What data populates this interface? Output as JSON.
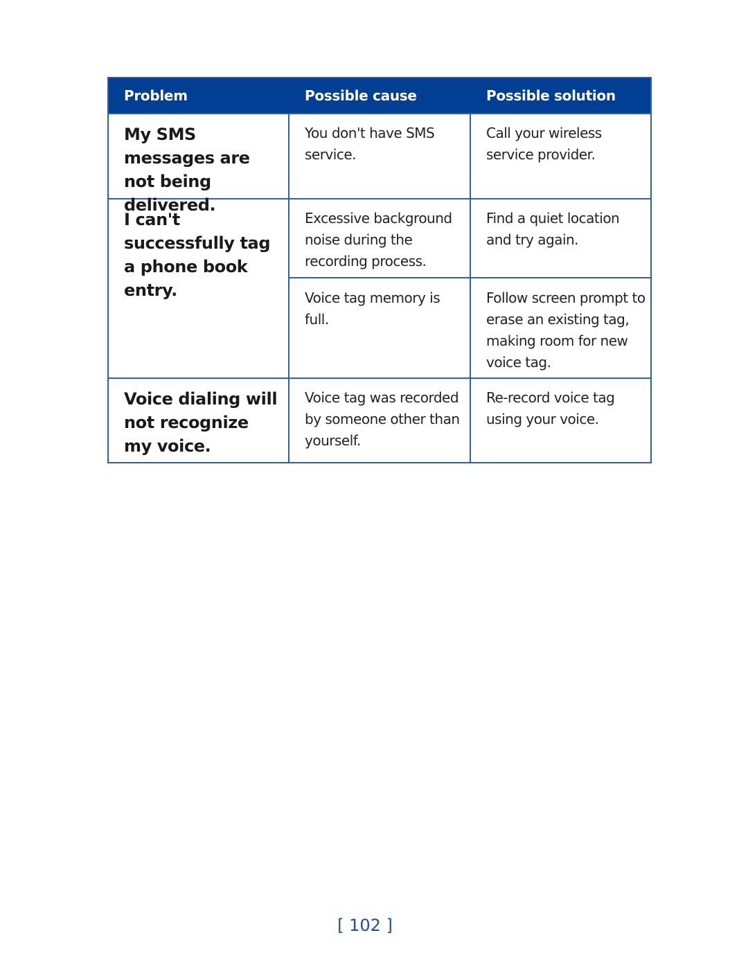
{
  "table": {
    "headers": [
      "Problem",
      "Possible cause",
      "Possible solution"
    ],
    "rows": [
      {
        "problem": "My SMS messages are not being delivered.",
        "entries": [
          {
            "cause": "You don't have SMS service.",
            "solution": "Call your wireless service provider."
          }
        ]
      },
      {
        "problem": "I can't successfully tag a phone book entry.",
        "entries": [
          {
            "cause": "Excessive background noise during the recording process.",
            "solution": "Find a quiet location and try again."
          },
          {
            "cause": "Voice tag memory is full.",
            "solution": "Follow screen prompt to erase an existing tag, making room for new voice tag."
          }
        ]
      },
      {
        "problem": "Voice dialing will not recognize my voice.",
        "entries": [
          {
            "cause": "Voice tag was recorded by someone other than yourself.",
            "solution": "Re-record voice tag using your voice."
          }
        ]
      }
    ]
  },
  "page_number": "[ 102 ]",
  "colors": {
    "header_bg": "#003f93",
    "border": "#2f5fa8",
    "page_number": "#1f4fa0"
  }
}
